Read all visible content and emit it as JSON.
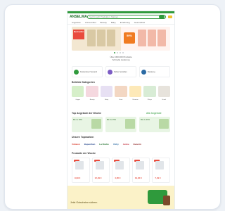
{
  "header": {
    "logo": "ANSELMA",
    "search_placeholder": "Sucht nach Produkten, Marken..."
  },
  "nav": [
    "Angebote",
    "Arzneimittel",
    "Beauty",
    "Baby",
    "Ernährung",
    "Gesundheit"
  ],
  "hero": {
    "left_label": "Bestseller",
    "discount": "50%"
  },
  "promo_text_1": "Über 300.000 Produkte",
  "promo_text_2": "Schnelle Lieferung",
  "info_items": [
    {
      "text": "Kostenloser Versand"
    },
    {
      "text": "Sicher bezahlen"
    },
    {
      "text": "Beratung"
    }
  ],
  "sections": {
    "categories_title": "Beliebte Kategorien",
    "deals_title": "Top Angebote der Woche",
    "deals_link": "Alle Angebote",
    "brands_title": "Unsere Topmarken",
    "products_title": "Produkte der Woche"
  },
  "categories": [
    {
      "label": "Grippe",
      "color": "#d6efc9"
    },
    {
      "label": "Beauty",
      "color": "#f5d8df"
    },
    {
      "label": "Baby",
      "color": "#e7e0f3"
    },
    {
      "label": "Haut",
      "color": "#f3d7c3"
    },
    {
      "label": "Vitamine",
      "color": "#fde9b8"
    },
    {
      "label": "Pflege",
      "color": "#d8ecd5"
    },
    {
      "label": "Hund",
      "color": "#e7e3dc"
    }
  ],
  "deals": [
    {
      "text": "Bis zu 30%"
    },
    {
      "text": "Bis zu 25%"
    },
    {
      "text": "Bis zu 20%"
    }
  ],
  "brands": [
    {
      "name": "Voltaren",
      "color": "#d93b2b"
    },
    {
      "name": "Bepanthen",
      "color": "#2a4a8f"
    },
    {
      "name": "La Roche",
      "color": "#1f6f2b"
    },
    {
      "name": "Vichy",
      "color": "#2b6aa3"
    },
    {
      "name": "Avène",
      "color": "#c73a48"
    },
    {
      "name": "Eucerin",
      "color": "#8a1d1d"
    }
  ],
  "products": [
    {
      "price": "9,99 €"
    },
    {
      "price": "12,49 €"
    },
    {
      "price": "4,95 €"
    },
    {
      "price": "19,90 €"
    },
    {
      "price": "7,49 €"
    }
  ],
  "footer_banner": {
    "text": "Jetzt Gutscheine sichern"
  }
}
